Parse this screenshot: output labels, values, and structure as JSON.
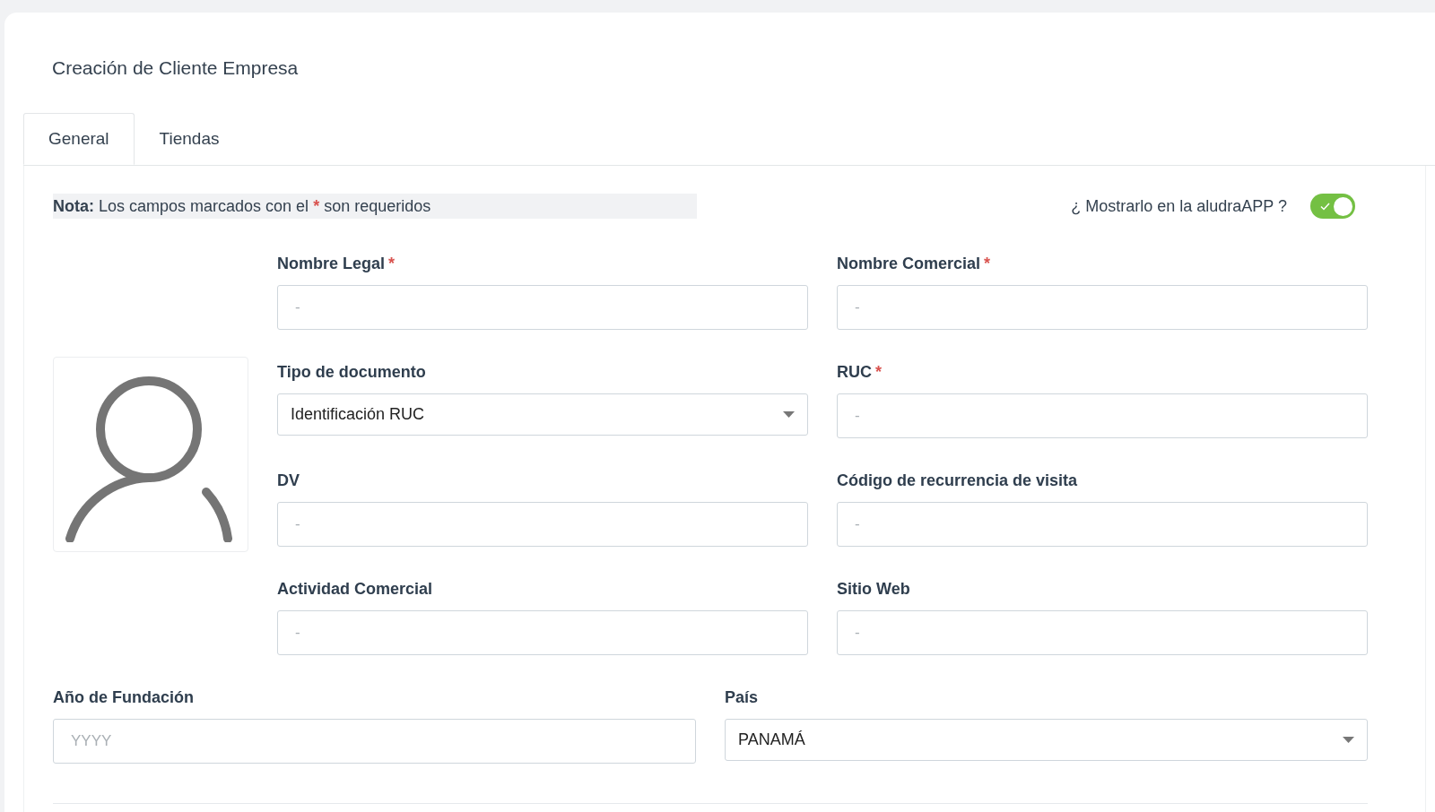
{
  "title": "Creación de Cliente Empresa",
  "tabs": [
    {
      "label": "General",
      "selected": true
    },
    {
      "label": "Tiendas",
      "selected": false
    }
  ],
  "note": {
    "text": "**Nota:** Los campos marcados con el",
    "mark": "*",
    "text_after": "son requeridos"
  },
  "show_in_app": {
    "label": "¿ Mostrarlo en la aludraAPP ?",
    "on": true
  },
  "required_mark": "*",
  "fields": [
    {
      "kind": "input",
      "label": "Nombre Legal",
      "required": true,
      "placeholder": "-"
    },
    {
      "kind": "input",
      "label": "Nombre Comercial",
      "required": true,
      "placeholder": "-"
    },
    {
      "kind": "select",
      "label": "Tipo de documento",
      "required": false,
      "value": "Identificación RUC"
    },
    {
      "kind": "input",
      "label": "RUC",
      "required": true,
      "placeholder": "-"
    },
    {
      "kind": "input",
      "label": "DV",
      "required": false,
      "placeholder": "-"
    },
    {
      "kind": "input",
      "label": "Código de recurrencia de visita",
      "required": false,
      "placeholder": "-"
    },
    {
      "kind": "input",
      "label": "Actividad Comercial",
      "required": false,
      "placeholder": "-"
    },
    {
      "kind": "input",
      "label": "Sitio Web",
      "required": false,
      "placeholder": "-"
    }
  ],
  "bottom_fields": [
    {
      "kind": "input",
      "label": "Año de Fundación",
      "required": false,
      "placeholder": "YYYY"
    },
    {
      "kind": "select",
      "label": "País",
      "required": false,
      "value": "PANAMÁ"
    }
  ]
}
